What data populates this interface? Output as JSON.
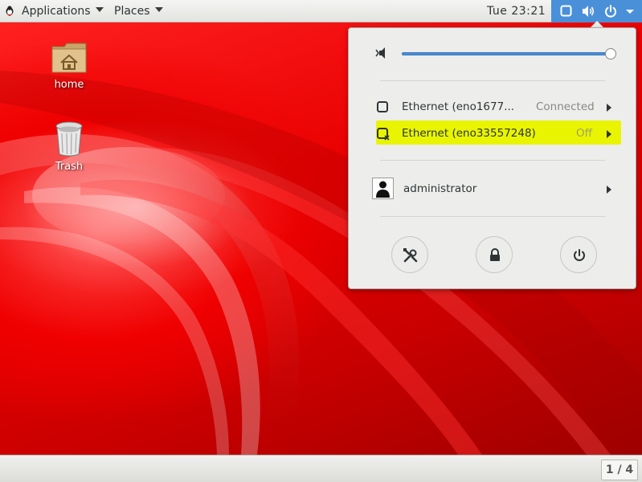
{
  "topbar": {
    "applications_label": "Applications",
    "places_label": "Places",
    "clock": "Tue 23:21"
  },
  "desktop": {
    "icons": [
      {
        "label": "home",
        "icon": "home-folder-icon"
      },
      {
        "label": "Trash",
        "icon": "trash-icon"
      }
    ]
  },
  "system_menu": {
    "volume": {
      "level": 1.0,
      "icon": "speaker-icon"
    },
    "network": [
      {
        "name": "Ethernet (eno1677...",
        "status": "Connected",
        "icon": "ethernet-connected-icon"
      },
      {
        "name": "Ethernet (eno33557248)",
        "status": "Off",
        "icon": "ethernet-disconnected-icon",
        "highlighted": true
      }
    ],
    "user": {
      "name": "administrator",
      "icon": "user-avatar-icon"
    },
    "actions": [
      {
        "icon": "settings-icon"
      },
      {
        "icon": "lock-icon"
      },
      {
        "icon": "power-icon"
      }
    ]
  },
  "bottombar": {
    "workspace": "1 / 4"
  },
  "colors": {
    "accent": "#4a90d9",
    "highlight": "#e9f500",
    "wallpaper": "#e80000"
  }
}
